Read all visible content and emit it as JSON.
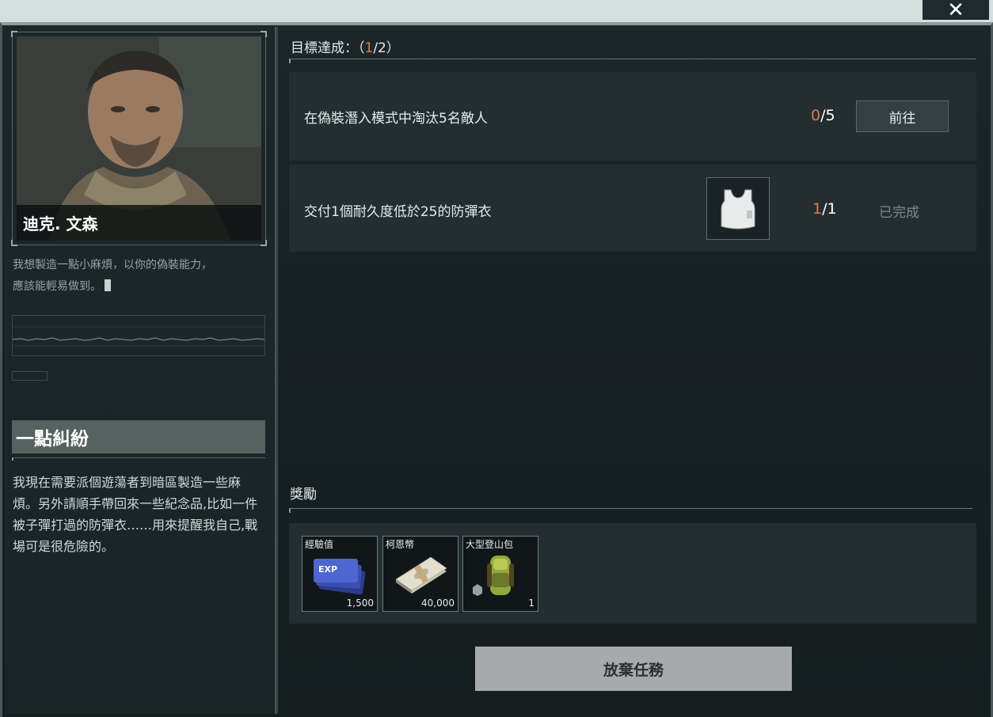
{
  "window": {
    "close_icon": "close-icon",
    "close_glyph": "✕"
  },
  "character": {
    "name": "迪克. 文森",
    "quote_line1": "我想製造一點小麻煩，以你的偽裝能力，",
    "quote_line2": "應該能輕易做到。"
  },
  "quest": {
    "title": "一點糾紛",
    "description": "我現在需要派個遊蕩者到暗區製造一些麻煩。另外請順手帶回來一些紀念品,比如一件被子彈打過的防彈衣……用來提醒我自己,戰場可是很危險的。"
  },
  "goals": {
    "label": "目標達成：",
    "paren_open": "（",
    "done": "1",
    "slash_total": "/2",
    "paren_close": "）",
    "objectives": [
      {
        "text": "在偽裝潛入模式中淘汰5名敵人",
        "current": "0",
        "total": "/5",
        "action_label": "前往"
      },
      {
        "text": "交付1個耐久度低於25的防彈衣",
        "item_icon": "body-armor-vest-icon",
        "current": "1",
        "total": "/1",
        "status_label": "已完成"
      }
    ]
  },
  "rewards": {
    "label": "獎勵",
    "items": [
      {
        "name": "經驗值",
        "quantity": "1,500",
        "icon": "exp-ticket-icon",
        "icon_text": "EXP"
      },
      {
        "name": "柯恩幣",
        "quantity": "40,000",
        "icon": "cash-stack-icon"
      },
      {
        "name": "大型登山包",
        "quantity": "1",
        "icon": "hiking-backpack-icon"
      }
    ]
  },
  "actions": {
    "abandon_label": "放棄任務"
  },
  "colors": {
    "highlight": "#e27a3f",
    "panel": "#242e31",
    "background": "#1a2326",
    "abandon_button": "#a7a9aa",
    "title_bar": "#56625f"
  }
}
